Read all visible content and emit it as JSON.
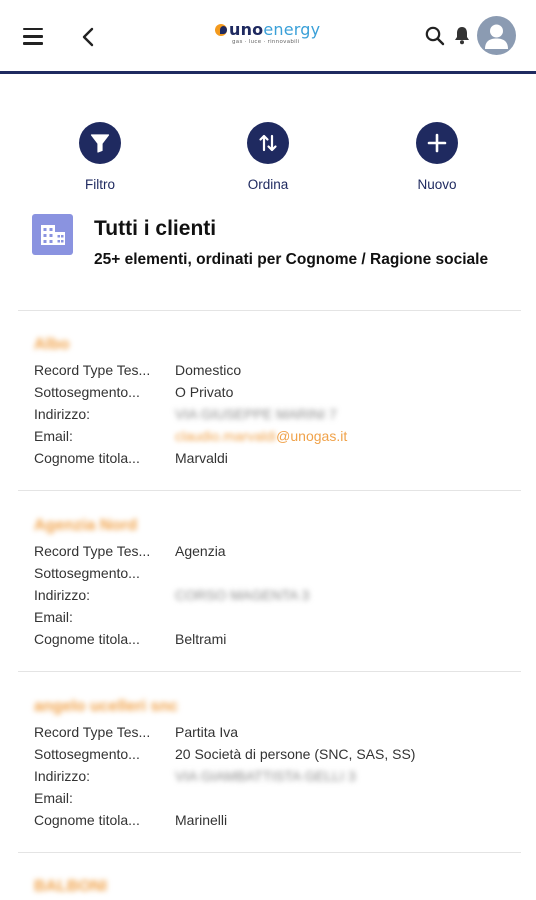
{
  "header": {
    "menu_icon": "hamburger-menu-icon",
    "back_icon": "chevron-left-icon",
    "logo": {
      "uno": "uno",
      "energy": "energy",
      "tagline": "gas · luce · rinnovabili"
    },
    "search_icon": "search-icon",
    "bell_icon": "bell-icon",
    "avatar_icon": "user-avatar-icon",
    "accent_line_color": "#1f2a60"
  },
  "actions": [
    {
      "label": "Filtro",
      "icon": "filter-funnel-icon"
    },
    {
      "label": "Ordina",
      "icon": "sort-arrows-icon"
    },
    {
      "label": "Nuovo",
      "icon": "plus-icon"
    }
  ],
  "list": {
    "title": "Tutti i clienti",
    "subtitle": "25+ elementi, ordinati per Cognome / Ragione sociale",
    "icon": "building-icon",
    "icon_color": "#8a93e0"
  },
  "field_labels": {
    "record_type": "Record Type Tes...",
    "sottosegmento": "Sottosegmento...",
    "indirizzo": "Indirizzo:",
    "email": "Email:",
    "cognome": "Cognome titola..."
  },
  "records": [
    {
      "name": "Albo",
      "record_type": "Domestico",
      "sottosegmento": "O Privato",
      "indirizzo": "VIA GIUSEPPE MARINI 7",
      "email_local": "claudio.marvaldi",
      "email_domain": "@unogas.it",
      "cognome": "Marvaldi"
    },
    {
      "name": "Agenzia Nord",
      "record_type": "Agenzia",
      "sottosegmento": "",
      "indirizzo": "CORSO MAGENTA 3",
      "email_local": "",
      "email_domain": "",
      "cognome": "Beltrami"
    },
    {
      "name": "angelo ucelleri snc",
      "record_type": "Partita Iva",
      "sottosegmento": "20 Società di persone (SNC, SAS, SS)",
      "indirizzo": "VIA GIAMBATTISTA GELLI 3",
      "email_local": "",
      "email_domain": "",
      "cognome": "Marinelli"
    },
    {
      "name": "BALBONI"
    }
  ],
  "colors": {
    "brand_navy": "#1f2a60",
    "brand_orange": "#f0a24a",
    "brand_blue": "#3aa0d8"
  }
}
